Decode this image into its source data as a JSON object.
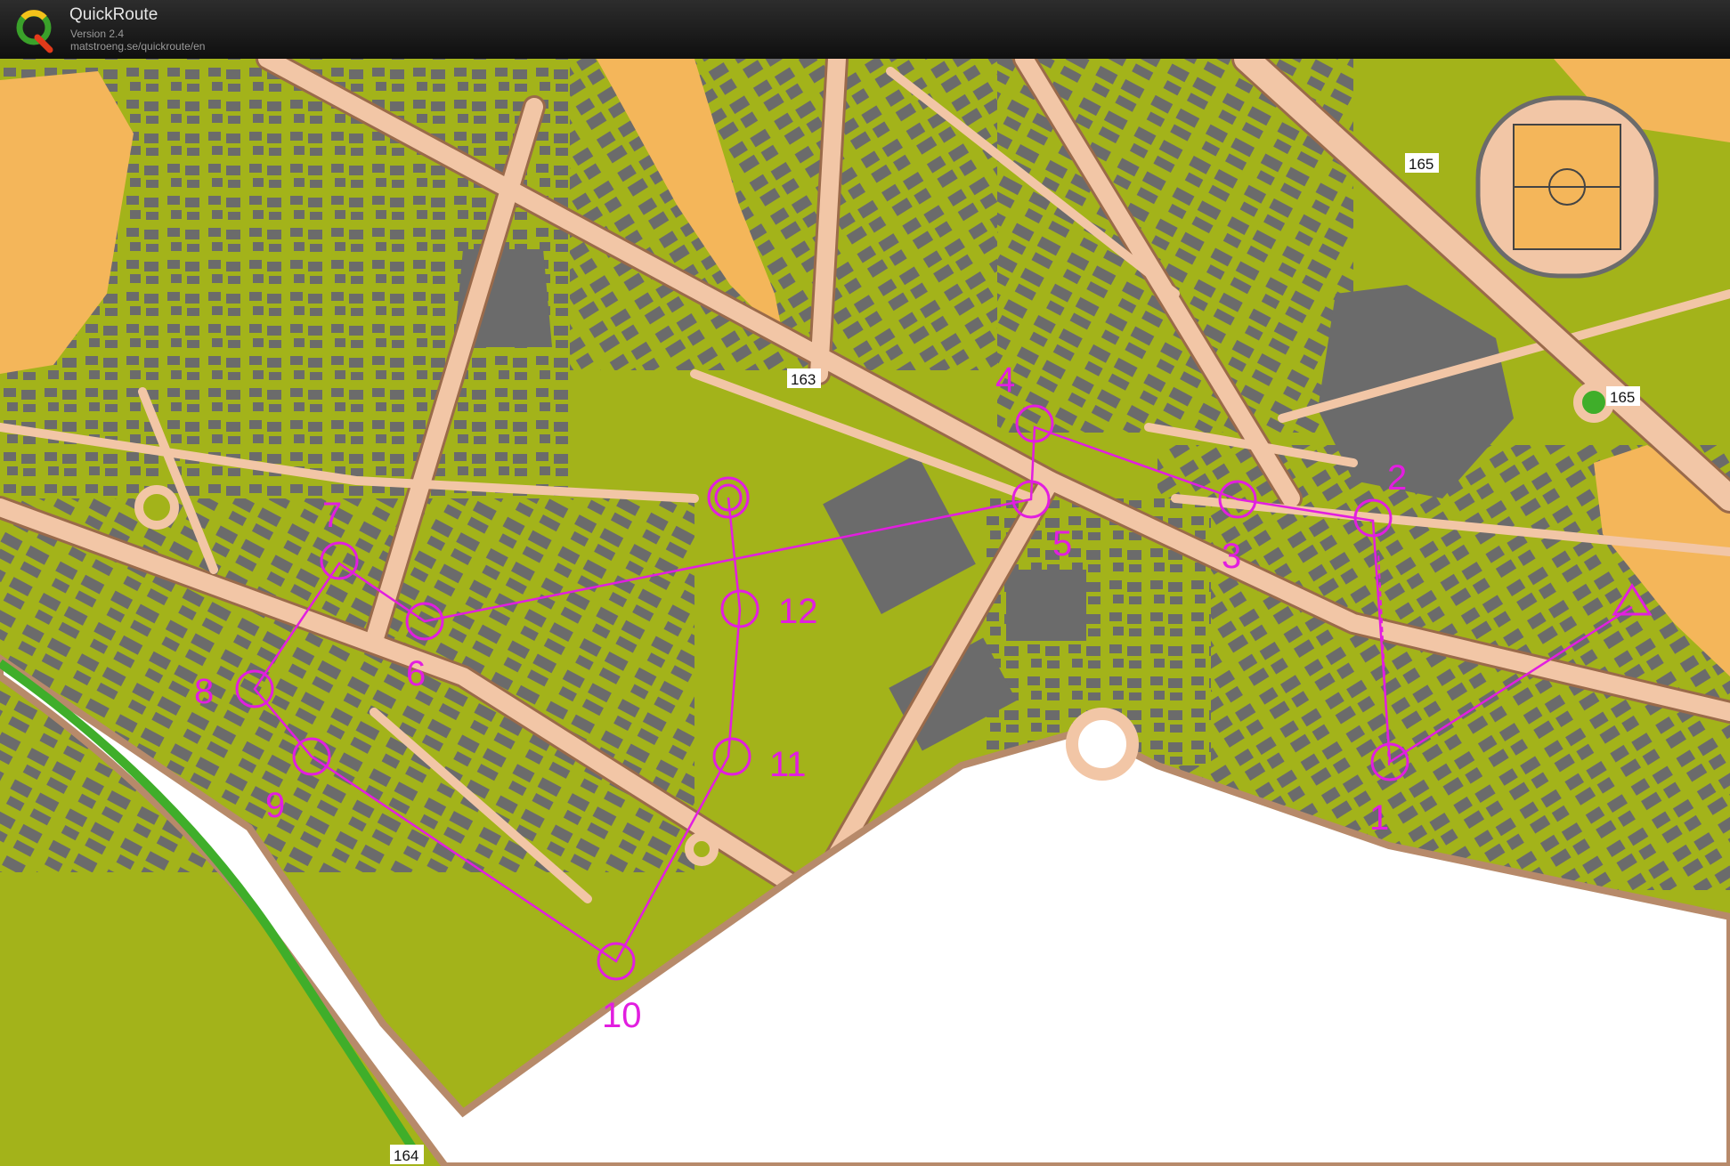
{
  "app": {
    "title": "QuickRoute",
    "version": "Version 2.4",
    "url": "matstroeng.se/quickroute/en",
    "logo_icon": "quickroute-q-logo-icon"
  },
  "map": {
    "course_color": "#e21ee0",
    "colors": {
      "vegetation": "#a3b31a",
      "open_land": "#f4b65a",
      "paved_area": "#f2c6a6",
      "building": "#6b6b6b",
      "water_white": "#ffffff",
      "road_edge": "#9a6a4a"
    },
    "start_icon": "start-triangle-icon",
    "control_icon": "control-circle-icon",
    "finish_icon": "finish-double-circle-icon",
    "controls": [
      {
        "label": "1"
      },
      {
        "label": "2"
      },
      {
        "label": "3"
      },
      {
        "label": "4"
      },
      {
        "label": "5"
      },
      {
        "label": "6"
      },
      {
        "label": "7"
      },
      {
        "label": "8"
      },
      {
        "label": "9"
      },
      {
        "label": "10"
      },
      {
        "label": "11"
      },
      {
        "label": "12"
      }
    ],
    "height_labels": [
      "163",
      "165",
      "165",
      "164"
    ]
  }
}
